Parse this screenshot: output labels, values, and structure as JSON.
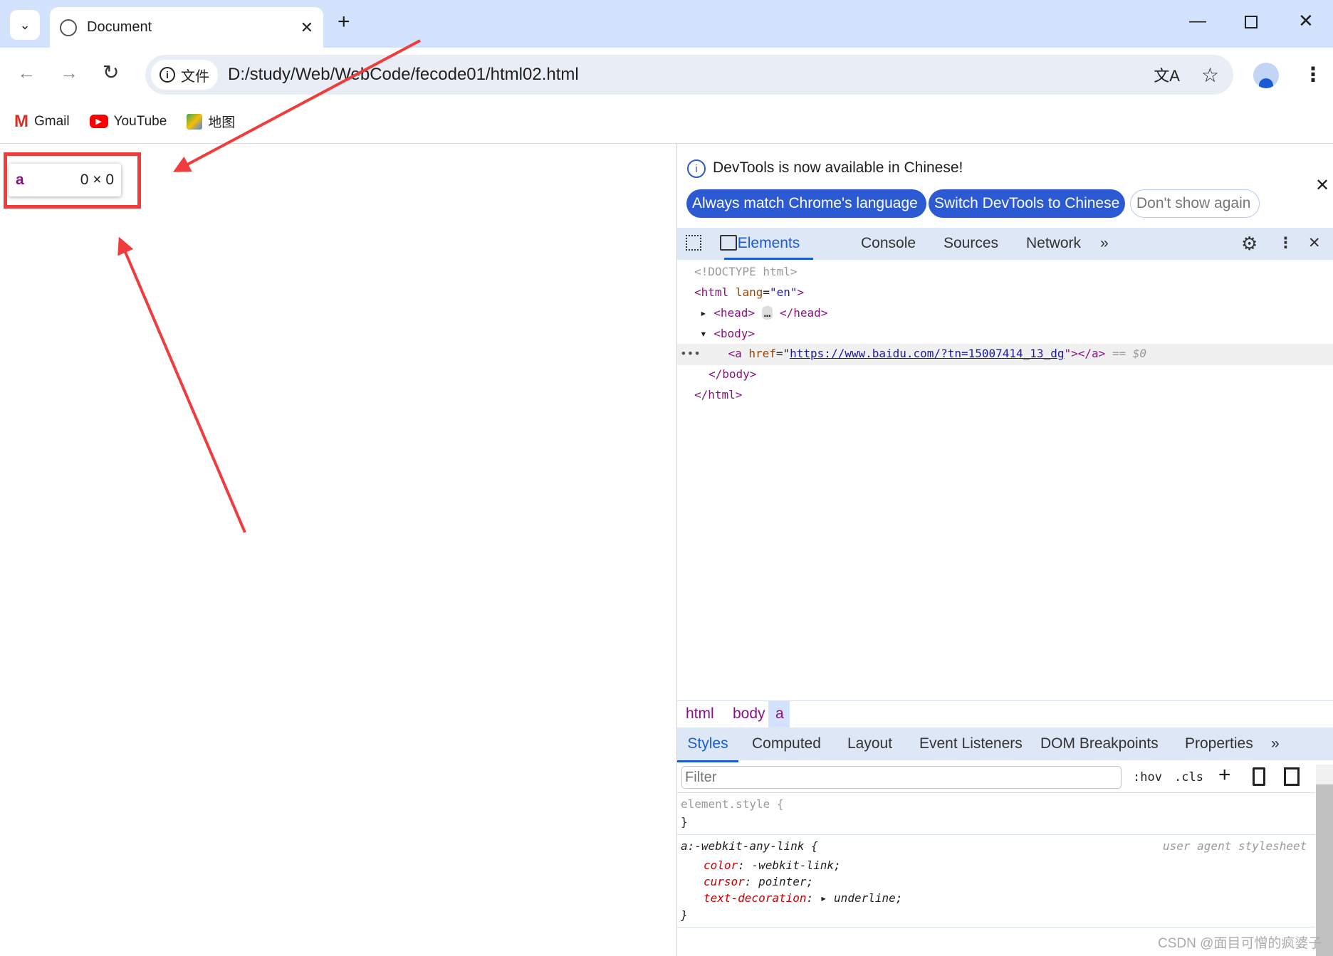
{
  "browser": {
    "tab_title": "Document",
    "address": "D:/study/Web/WebCode/fecode01/html02.html",
    "address_chip": "文件",
    "bookmarks": [
      {
        "label": "Gmail"
      },
      {
        "label": "YouTube"
      },
      {
        "label": "地图"
      }
    ]
  },
  "page": {
    "tooltip": {
      "tag": "a",
      "size": "0 × 0"
    },
    "annotation_color": "#f03c3c"
  },
  "devtools": {
    "infobar": {
      "message": "DevTools is now available in Chinese!",
      "btn_match": "Always match Chrome's language",
      "btn_switch": "Switch DevTools to Chinese",
      "btn_dont": "Don't show again"
    },
    "tabs": [
      "Elements",
      "Console",
      "Sources",
      "Network"
    ],
    "dom": {
      "doctype": "<!DOCTYPE html>",
      "html_open": "<html",
      "lang_attr": "lang",
      "lang_val": "\"en\"",
      "head": "<head>",
      "head_close": "</head>",
      "body": "<body>",
      "a_open": "<a",
      "href_attr": "href",
      "href_val": "https://www.baidu.com/?tn=15007414_13_dg",
      "a_close": "\"></a>",
      "sel_marker": "== $0",
      "body_close": "</body>",
      "html_close": "</html>"
    },
    "breadcrumb": [
      "html",
      "body",
      "a"
    ],
    "style_tabs": [
      "Styles",
      "Computed",
      "Layout",
      "Event Listeners",
      "DOM Breakpoints",
      "Properties"
    ],
    "filter_placeholder": "Filter",
    "hov": ":hov",
    "cls": ".cls",
    "rules": {
      "element_style": "element.style {",
      "close": "}",
      "ua_selector": "a:-webkit-any-link {",
      "ua_source": "user agent stylesheet",
      "decls": [
        {
          "prop": "color",
          "val": "-webkit-link;"
        },
        {
          "prop": "cursor",
          "val": "pointer;"
        },
        {
          "prop": "text-decoration",
          "val": "underline;"
        }
      ]
    }
  },
  "watermark": "CSDN @面目可憎的疯婆子"
}
